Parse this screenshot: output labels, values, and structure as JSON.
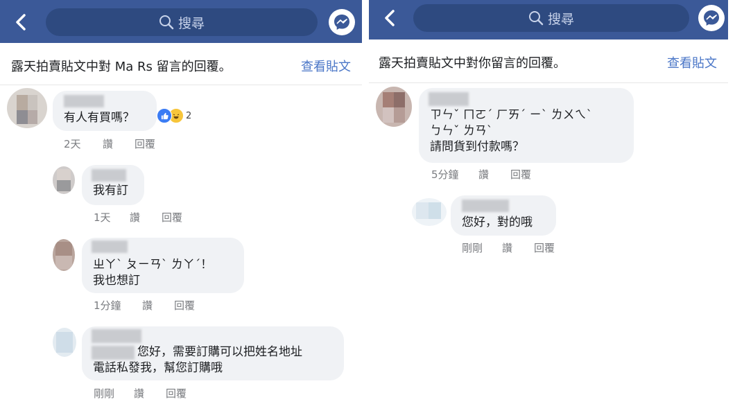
{
  "left": {
    "search_placeholder": "搜尋",
    "header_title": "露天拍賣貼文中對 Ma Rs 留言的回覆。",
    "view_post": "查看貼文",
    "comments": [
      {
        "text_lines": [
          "有人有買嗎？"
        ],
        "time": "2天",
        "like": "讚",
        "reply": "回覆",
        "reaction_count": "2"
      },
      {
        "text_lines": [
          "我有訂"
        ],
        "time": "1天",
        "like": "讚",
        "reply": "回覆"
      },
      {
        "text_lines": [
          "ㄓㄚˋ ㄆㄧㄢˋ ㄌㄚˊ！",
          "我也想訂"
        ],
        "time": "1分鐘",
        "like": "讚",
        "reply": "回覆"
      },
      {
        "text_lines": [
          "您好，需要訂購可以把姓名地址",
          "電話私發我，幫您訂購哦"
        ],
        "time": "剛剛",
        "like": "讚",
        "reply": "回覆"
      }
    ]
  },
  "right": {
    "search_placeholder": "搜尋",
    "header_title": "露天拍賣貼文中對你留言的回覆。",
    "view_post": "查看貼文",
    "comments": [
      {
        "text_lines": [
          "ㄗㄣˇ ㄇㄛˊ ㄏㄞˊ ㄧˋ ㄌㄨㄟˋ",
          "ㄅㄣˇ ㄌㄢˋ",
          "請問貨到付款嗎？"
        ],
        "time": "5分鐘",
        "like": "讚",
        "reply": "回覆"
      },
      {
        "text_lines": [
          "您好，對的哦"
        ],
        "time": "剛剛",
        "like": "讚",
        "reply": "回覆"
      }
    ]
  },
  "colors": {
    "topbar": "#3b5998",
    "search_bg": "#2e4a80",
    "link": "#4a76c7",
    "bubble": "#f0f2f5"
  },
  "icons": [
    "back-chevron-icon",
    "search-icon",
    "messenger-icon",
    "like-reaction-icon",
    "haha-reaction-icon"
  ]
}
